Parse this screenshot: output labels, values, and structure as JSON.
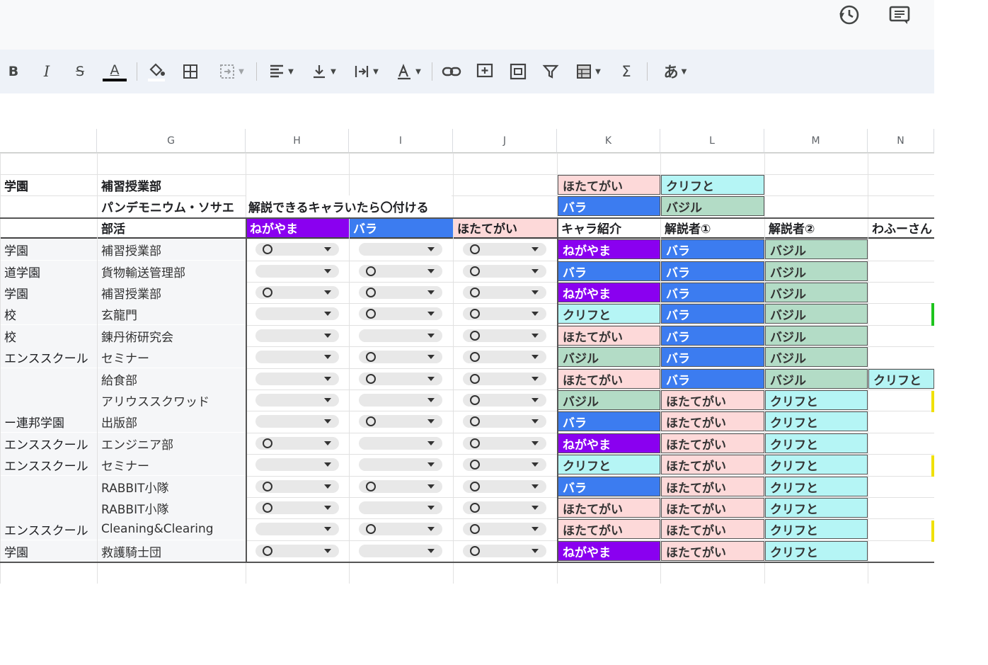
{
  "top_icons": [
    "history-icon",
    "comment-icon"
  ],
  "toolbar": {
    "bold": "B",
    "italic": "I",
    "strike": "S",
    "text_color": "A",
    "function": "Σ",
    "input_tools": "あ"
  },
  "columns": [
    "G",
    "H",
    "I",
    "J",
    "K",
    "L",
    "M",
    "N"
  ],
  "row1": {
    "f": "学園",
    "g": "補習授業部",
    "k": "ほたてがい",
    "l": "クリフと"
  },
  "row2": {
    "g": "パンデモニウム・ソサエ",
    "h": "解説できるキャラいたら〇付ける",
    "k": "バラ",
    "l": "バジル"
  },
  "header_row": {
    "g": "部活",
    "h": "ねがやま",
    "i": "バラ",
    "j": "ほたてがい",
    "k": "キャラ紹介",
    "l": "解説者①",
    "m": "解説者②",
    "n": "わふーさん"
  },
  "rows": [
    {
      "f": "学園",
      "g": "補習授業部",
      "h": "〇",
      "i": "",
      "j": "〇",
      "k": "ねがやま",
      "l": "バラ",
      "m": "バジル",
      "n": ""
    },
    {
      "f": "道学園",
      "g": "貨物輸送管理部",
      "h": "",
      "i": "〇",
      "j": "〇",
      "k": "バラ",
      "l": "バラ",
      "m": "バジル",
      "n": ""
    },
    {
      "f": "学園",
      "g": "補習授業部",
      "h": "〇",
      "i": "〇",
      "j": "〇",
      "k": "ねがやま",
      "l": "バラ",
      "m": "バジル",
      "n": ""
    },
    {
      "f": "校",
      "g": "玄龍門",
      "h": "",
      "i": "〇",
      "j": "〇",
      "k": "クリフと",
      "l": "バラ",
      "m": "バジル",
      "n": ""
    },
    {
      "f": "校",
      "g": "錬丹術研究会",
      "h": "",
      "i": "",
      "j": "〇",
      "k": "ほたてがい",
      "l": "バラ",
      "m": "バジル",
      "n": ""
    },
    {
      "f": "エンススクール",
      "g": "セミナー",
      "h": "",
      "i": "〇",
      "j": "〇",
      "k": "バジル",
      "l": "バラ",
      "m": "バジル",
      "n": ""
    },
    {
      "f": "",
      "g": "給食部",
      "h": "",
      "i": "〇",
      "j": "〇",
      "k": "ほたてがい",
      "l": "バラ",
      "m": "バジル",
      "n": "クリフと"
    },
    {
      "f": "",
      "g": "アリウススクワッド",
      "h": "",
      "i": "",
      "j": "〇",
      "k": "バジル",
      "l": "ほたてがい",
      "m": "クリフと",
      "n": ""
    },
    {
      "f": "ー連邦学園",
      "g": "出版部",
      "h": "",
      "i": "〇",
      "j": "〇",
      "k": "バラ",
      "l": "ほたてがい",
      "m": "クリフと",
      "n": ""
    },
    {
      "f": "エンススクール",
      "g": "エンジニア部",
      "h": "〇",
      "i": "",
      "j": "〇",
      "k": "ねがやま",
      "l": "ほたてがい",
      "m": "クリフと",
      "n": ""
    },
    {
      "f": "エンススクール",
      "g": "セミナー",
      "h": "",
      "i": "",
      "j": "〇",
      "k": "クリフと",
      "l": "ほたてがい",
      "m": "クリフと",
      "n": ""
    },
    {
      "f": "",
      "g": "RABBIT小隊",
      "h": "〇",
      "i": "〇",
      "j": "〇",
      "k": "バラ",
      "l": "ほたてがい",
      "m": "クリフと",
      "n": ""
    },
    {
      "f": "",
      "g": "RABBIT小隊",
      "h": "〇",
      "i": "",
      "j": "〇",
      "k": "ほたてがい",
      "l": "ほたてがい",
      "m": "クリフと",
      "n": ""
    },
    {
      "f": "エンススクール",
      "g": "Cleaning&Clearing",
      "h": "",
      "i": "〇",
      "j": "〇",
      "k": "ほたてがい",
      "l": "ほたてがい",
      "m": "クリフと",
      "n": ""
    },
    {
      "f": "学園",
      "g": "救護騎士団",
      "h": "〇",
      "i": "",
      "j": "〇",
      "k": "ねがやま",
      "l": "ほたてがい",
      "m": "クリフと",
      "n": ""
    }
  ],
  "colors": {
    "negayama": "#8a00f0",
    "bara": "#3c7cf0",
    "hotategai": "#fdd9d9",
    "basil": "#b3dcc6",
    "clift": "#b5f5f5",
    "topbar": "#f8f9fa",
    "toolbar": "#eef2f8"
  }
}
